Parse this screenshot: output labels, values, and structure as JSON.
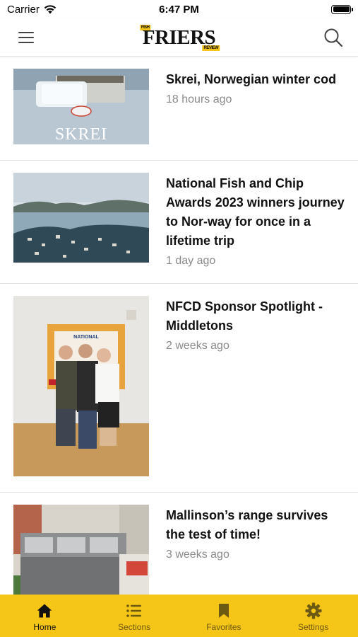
{
  "status_bar": {
    "carrier": "Carrier",
    "time": "6:47 PM"
  },
  "header": {
    "logo_text": "FRIERS",
    "logo_top_tag": "FISH",
    "logo_bottom_tag": "REVIEW",
    "menu_icon": "hamburger-menu-icon",
    "search_icon": "search-icon"
  },
  "articles": [
    {
      "title": "Skrei, Norwegian winter cod",
      "time": "18 hours ago",
      "image_caption": "SKREI"
    },
    {
      "title": "National Fish and Chip Awards 2023 winners journey to Nor-way for once in a lifetime trip",
      "time": "1 day ago"
    },
    {
      "title": "NFCD Sponsor Spotlight - Middletons",
      "time": "2 weeks ago",
      "image_caption": "NATIONAL"
    },
    {
      "title": "Mallinson’s range survives the test of time!",
      "time": "3 weeks ago"
    }
  ],
  "tabs": [
    {
      "label": "Home",
      "icon": "home-icon",
      "active": true
    },
    {
      "label": "Sections",
      "icon": "list-icon",
      "active": false
    },
    {
      "label": "Favorites",
      "icon": "bookmark-icon",
      "active": false
    },
    {
      "label": "Settings",
      "icon": "gear-icon",
      "active": false
    }
  ],
  "colors": {
    "accent": "#f5c518",
    "inactive_tab": "#6d5a12",
    "timestamp": "#8a8a8a"
  }
}
